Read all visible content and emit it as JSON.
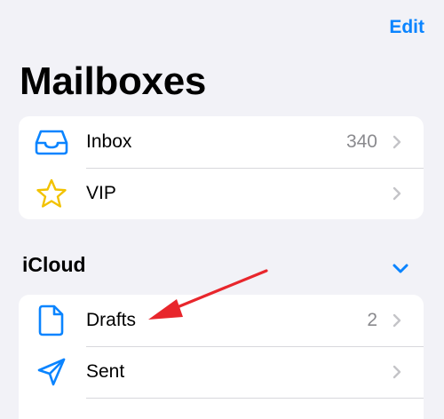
{
  "header": {
    "edit_label": "Edit",
    "title": "Mailboxes"
  },
  "mailboxes": [
    {
      "label": "Inbox",
      "count": "340",
      "icon": "inbox-tray-icon"
    },
    {
      "label": "VIP",
      "count": "",
      "icon": "star-icon"
    }
  ],
  "icloud": {
    "title": "iCloud",
    "items": [
      {
        "label": "Drafts",
        "count": "2",
        "icon": "document-icon"
      },
      {
        "label": "Sent",
        "count": "",
        "icon": "paper-plane-icon"
      }
    ]
  },
  "colors": {
    "accent": "#0a84ff",
    "star": "#f2c200",
    "background": "#f2f2f7",
    "annotation_arrow": "#e8262c"
  }
}
